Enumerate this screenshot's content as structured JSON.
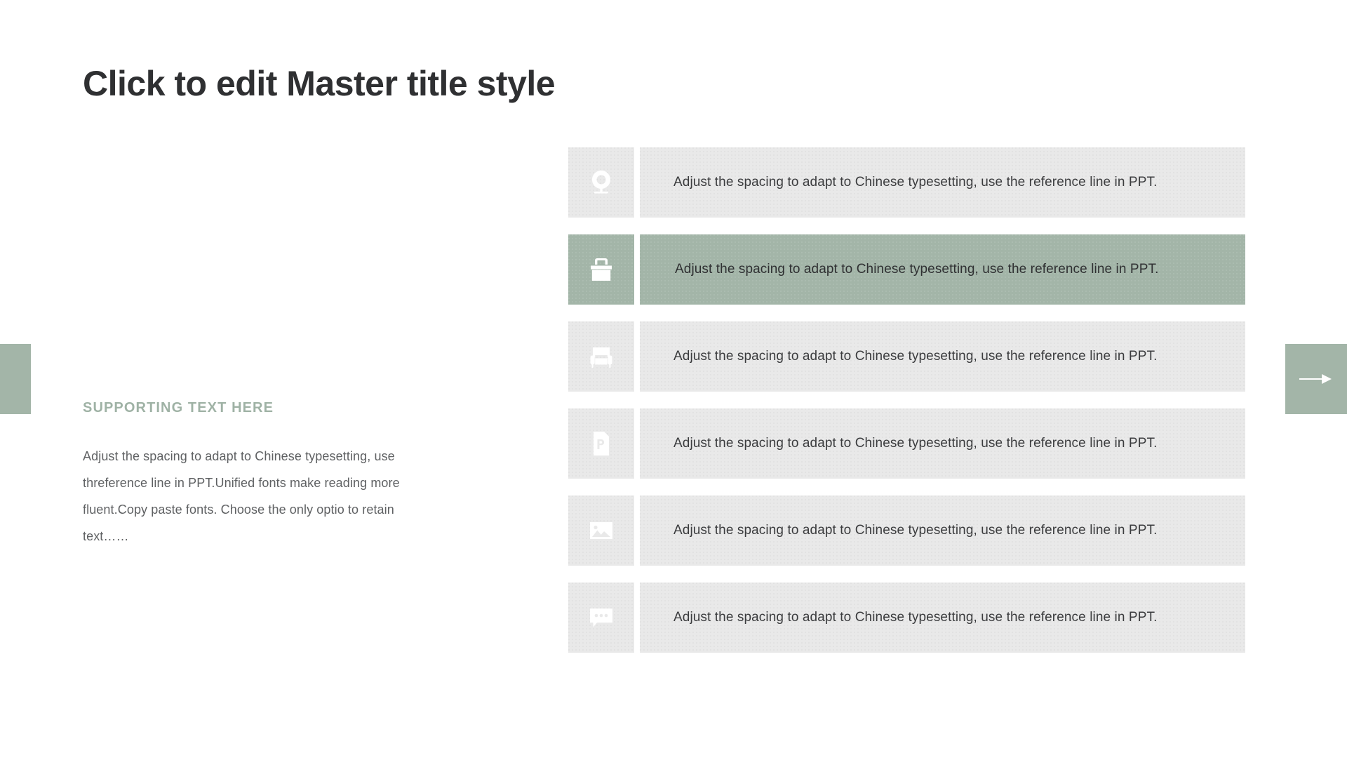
{
  "slide": {
    "title": "Click to edit Master title style",
    "background_color": "#ffffff",
    "accent_color": "#a3b5a8",
    "tile_color": "#e9e9e9",
    "title_color": "#2f3032"
  },
  "left_panel": {
    "supporting_heading": "SUPPORTING TEXT HERE",
    "supporting_body": "Adjust the spacing to adapt to Chinese typesetting, use threference line in PPT.Unified fonts make reading more fluent.Copy paste fonts. Choose the only optio to retain text……"
  },
  "rows": [
    {
      "icon": "webcam-icon",
      "text": "Adjust the spacing to adapt to Chinese typesetting, use the reference line in PPT.",
      "active": false
    },
    {
      "icon": "toolbox-icon",
      "text": "Adjust the spacing to adapt to Chinese typesetting, use the reference line in PPT.",
      "active": true
    },
    {
      "icon": "armchair-icon",
      "text": "Adjust the spacing to adapt to Chinese typesetting, use the reference line in PPT.",
      "active": false
    },
    {
      "icon": "ppt-document-icon",
      "text": "Adjust the spacing to adapt to Chinese typesetting, use the reference line in PPT.",
      "active": false
    },
    {
      "icon": "image-icon",
      "text": "Adjust the spacing to adapt to Chinese typesetting, use the reference line in PPT.",
      "active": false
    },
    {
      "icon": "chat-bubble-icon",
      "text": "Adjust the spacing to adapt to Chinese typesetting, use the reference line in PPT.",
      "active": false
    }
  ],
  "navigation": {
    "prev_label": "",
    "next_label": "",
    "next_icon": "arrow-right-icon",
    "prev_icon": "nav-tab-blank"
  }
}
